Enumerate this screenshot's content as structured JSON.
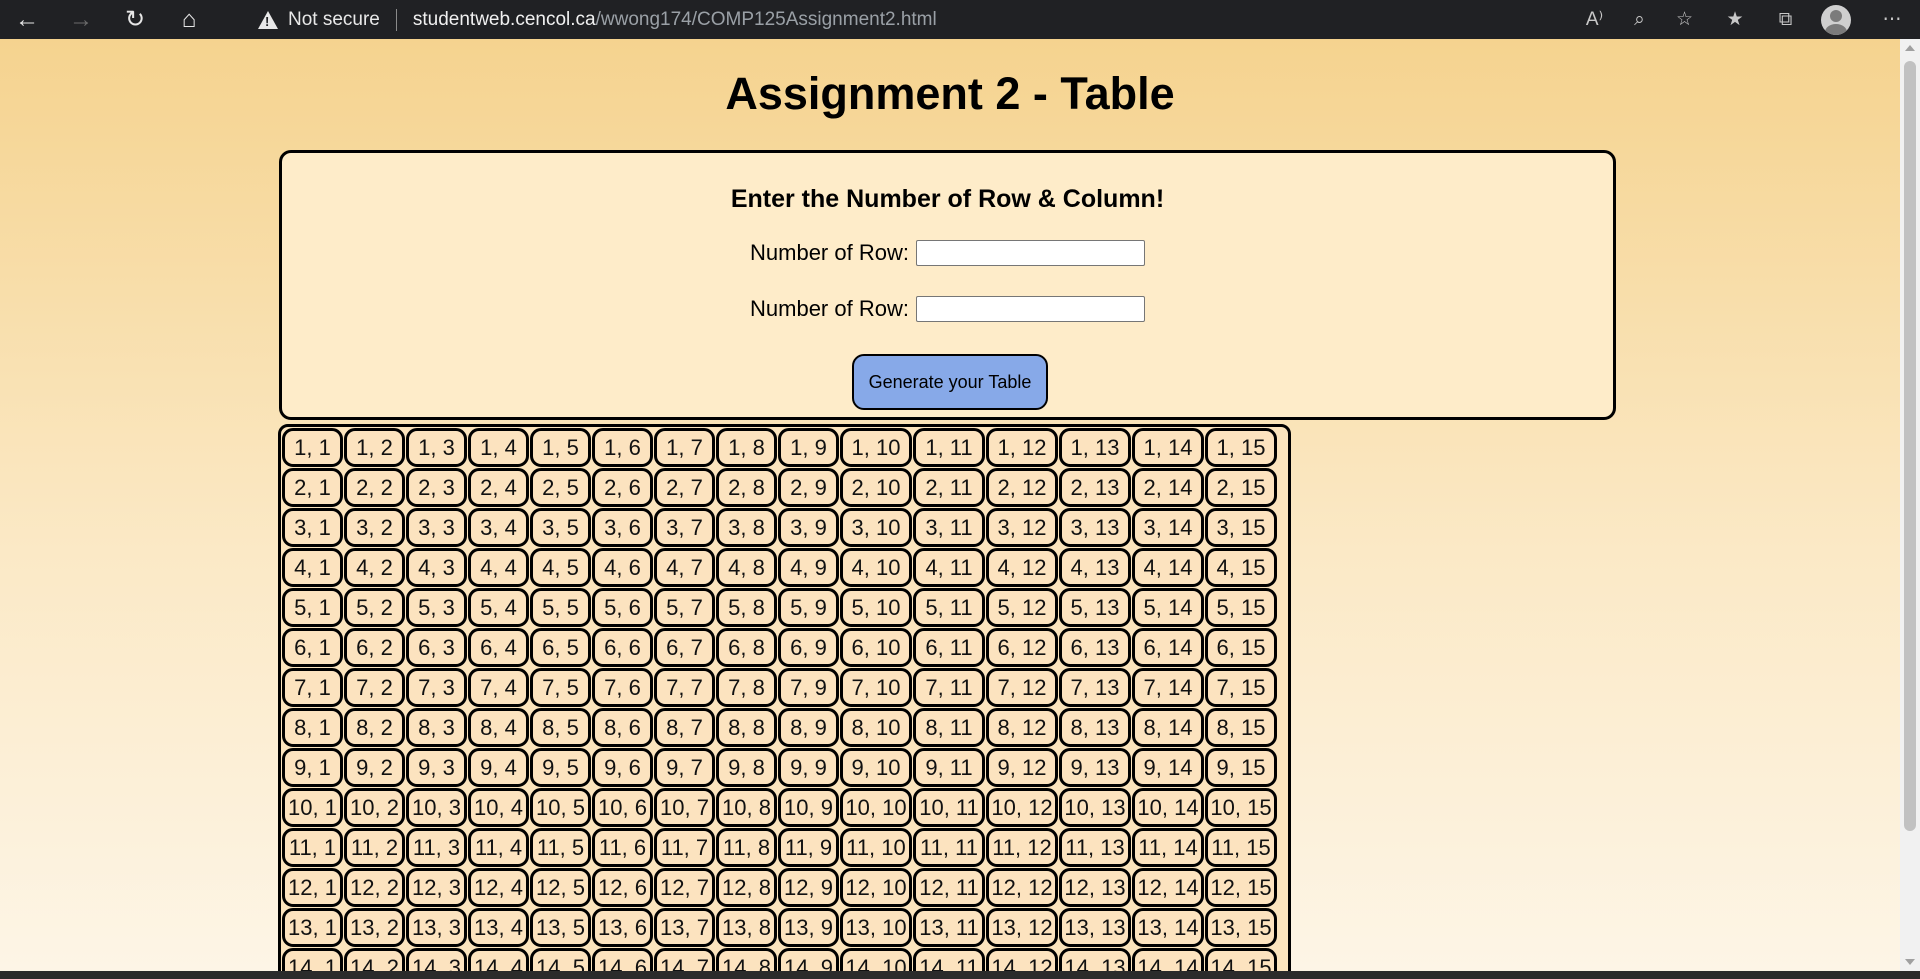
{
  "browser": {
    "security_text": "Not secure",
    "url_host": "studentweb.cencol.ca",
    "url_path": "/wwong174/COMP125Assignment2.html"
  },
  "page": {
    "title": "Assignment 2 - Table",
    "form_title": "Enter the Number of Row & Column!",
    "row_label": "Number of Row:",
    "row_value": "",
    "col_label": "Number of Row:",
    "col_value": "",
    "button_label": "Generate your Table"
  },
  "table": {
    "rows": 14,
    "cols": 15,
    "cell_format": "r, c"
  }
}
